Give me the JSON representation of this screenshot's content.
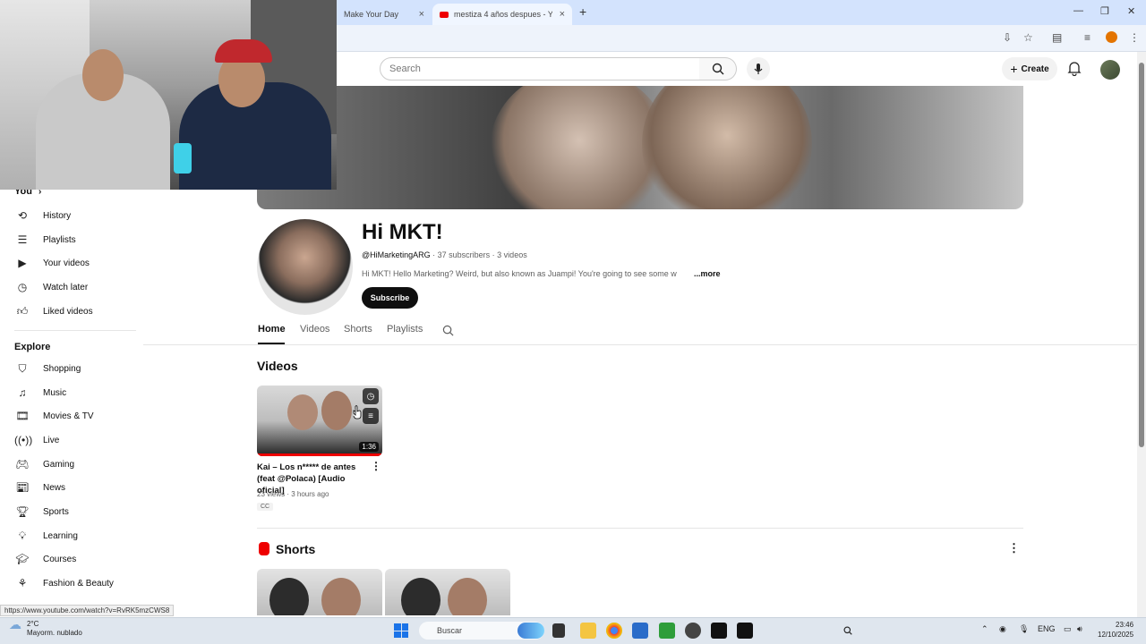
{
  "browser": {
    "tabs": [
      {
        "label": "Make Your Day"
      },
      {
        "label": "mestiza 4 años despues - YouTu"
      }
    ],
    "new_tab_glyph": "+",
    "close_glyph": "×"
  },
  "header": {
    "search_placeholder": "Search",
    "create_label": "Create"
  },
  "sidebar": {
    "you_label": "You",
    "you_items": [
      {
        "label": "History",
        "icon": "history-icon"
      },
      {
        "label": "Playlists",
        "icon": "playlists-icon"
      },
      {
        "label": "Your videos",
        "icon": "your-videos-icon"
      },
      {
        "label": "Watch later",
        "icon": "watch-later-icon"
      },
      {
        "label": "Liked videos",
        "icon": "liked-icon"
      }
    ],
    "explore_label": "Explore",
    "explore_items": [
      {
        "label": "Shopping",
        "icon": "shopping-icon"
      },
      {
        "label": "Music",
        "icon": "music-icon"
      },
      {
        "label": "Movies & TV",
        "icon": "movies-icon"
      },
      {
        "label": "Live",
        "icon": "live-icon"
      },
      {
        "label": "Gaming",
        "icon": "gaming-icon"
      },
      {
        "label": "News",
        "icon": "news-icon"
      },
      {
        "label": "Sports",
        "icon": "sports-icon"
      },
      {
        "label": "Learning",
        "icon": "learning-icon"
      },
      {
        "label": "Courses",
        "icon": "courses-icon"
      },
      {
        "label": "Fashion & Beauty",
        "icon": "fashion-icon"
      }
    ]
  },
  "channel": {
    "name": "Hi MKT!",
    "handle": "@HiMarketingARG",
    "stats": " · 37 subscribers · 3 videos",
    "description": "Hi MKT! Hello Marketing? Weird, but also known as Juampi! You're going to see some w",
    "more": "...more",
    "subscribe": "Subscribe",
    "tabs": [
      "Home",
      "Videos",
      "Shorts",
      "Playlists"
    ]
  },
  "videos_section": {
    "title": "Videos",
    "video": {
      "title": "Kai – Los n***** de antes (feat @Polaca) [Audio oficial]",
      "meta": "23 views · 3 hours ago",
      "badge": "CC",
      "duration": "1:36",
      "watched_fraction": 1.0
    }
  },
  "shorts_section": {
    "title": "Shorts"
  },
  "status_url": "https://www.youtube.com/watch?v=RvRK5mzCWS8",
  "taskbar": {
    "temp": "2°C",
    "weather": "Mayorm. nublado",
    "search": "Buscar",
    "lang": "ENG",
    "time": "23:46",
    "date": "12/10/2025"
  },
  "colors": {
    "accent_red": "#e00000",
    "subscribe_bg": "#0f0f0f",
    "tab_bar": "#d3e3fd"
  }
}
